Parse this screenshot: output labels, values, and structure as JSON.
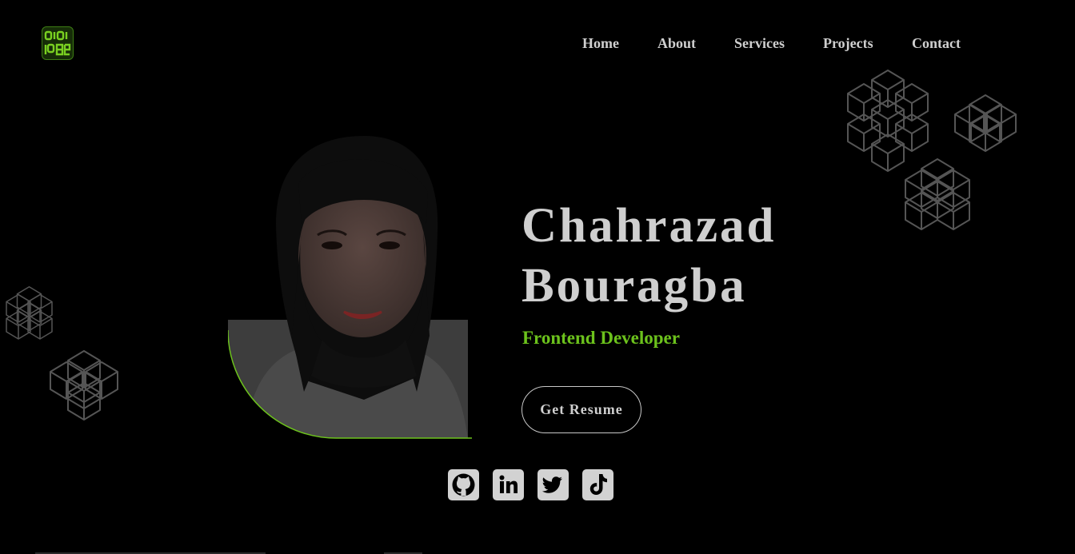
{
  "header": {
    "logo_icon": "code-logo-icon",
    "nav": [
      {
        "label": "Home"
      },
      {
        "label": "About"
      },
      {
        "label": "Services"
      },
      {
        "label": "Projects"
      },
      {
        "label": "Contact"
      }
    ]
  },
  "hero": {
    "name_line1": "Chahrazad",
    "name_line2": "Bouragba",
    "role": "Frontend Developer",
    "resume_button": "Get Resume",
    "photo": "profile-photo"
  },
  "social": [
    {
      "icon": "github-icon"
    },
    {
      "icon": "linkedin-icon"
    },
    {
      "icon": "twitter-icon"
    },
    {
      "icon": "tiktok-icon"
    }
  ],
  "colors": {
    "background": "#000000",
    "text": "#cfcfcf",
    "accent": "#6cc21c"
  }
}
